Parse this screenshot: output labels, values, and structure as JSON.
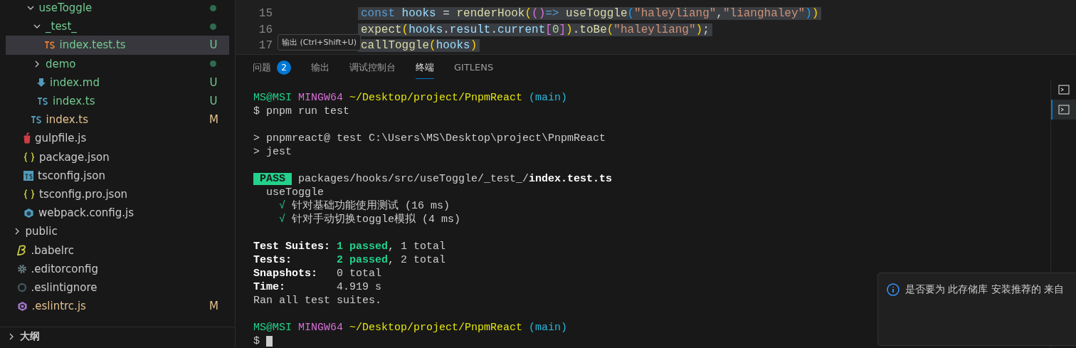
{
  "explorer": {
    "tree": [
      {
        "children": [
          {
            "children": [
              {
                "label": "useToggle",
                "kind": "folder",
                "expanded": true,
                "color": "#73c991",
                "selected": false,
                "dot": true,
                "children": [
                  {
                    "label": "_test_",
                    "kind": "folder",
                    "expanded": true,
                    "color": "#73c991",
                    "selected": false,
                    "dot": true,
                    "children": [
                      {
                        "label": "index.test.ts",
                        "kind": "ts-test",
                        "color": "#73c991",
                        "selected": true,
                        "badge": "U"
                      }
                    ]
                  },
                  {
                    "label": "demo",
                    "kind": "folder",
                    "expanded": false,
                    "color": "#73c991",
                    "selected": false,
                    "dot": true
                  },
                  {
                    "label": "index.md",
                    "kind": "md",
                    "color": "#73c991",
                    "selected": false,
                    "badge": "U"
                  },
                  {
                    "label": "index.ts",
                    "kind": "ts",
                    "color": "#73c991",
                    "selected": false,
                    "badge": "U"
                  }
                ]
              },
              {
                "label": "index.ts",
                "kind": "ts",
                "color": "#e2c08d",
                "selected": false,
                "badge": "M"
              }
            ]
          },
          {
            "label": "gulpfile.js",
            "kind": "gulp",
            "color": "#cccccc",
            "selected": false
          },
          {
            "label": "package.json",
            "kind": "json",
            "color": "#cccccc",
            "selected": false
          },
          {
            "label": "tsconfig.json",
            "kind": "tsconfig",
            "color": "#cccccc",
            "selected": false
          },
          {
            "label": "tsconfig.pro.json",
            "kind": "json",
            "color": "#cccccc",
            "selected": false
          },
          {
            "label": "webpack.config.js",
            "kind": "webpack",
            "color": "#cccccc",
            "selected": false
          }
        ]
      },
      {
        "label": "public",
        "kind": "folder",
        "expanded": false,
        "color": "#cccccc",
        "selected": false
      },
      {
        "label": ".babelrc",
        "kind": "babel",
        "color": "#cccccc",
        "selected": false
      },
      {
        "label": ".editorconfig",
        "kind": "gear",
        "color": "#cccccc",
        "selected": false
      },
      {
        "label": ".eslintignore",
        "kind": "ignore",
        "color": "#cccccc",
        "selected": false
      },
      {
        "label": ".eslintrc.js",
        "kind": "eslint",
        "color": "#e2c08d",
        "selected": false,
        "badge": "M"
      }
    ],
    "sections": [
      {
        "label": "大纲",
        "expanded": false
      }
    ]
  },
  "editor": {
    "lines": [
      {
        "number": "15",
        "tokens": [
          {
            "t": "const ",
            "kind": "keyword"
          },
          {
            "t": "hooks",
            "kind": "var"
          },
          {
            "t": " = ",
            "kind": "plain"
          },
          {
            "t": "renderHook",
            "kind": "func"
          },
          {
            "t": "(",
            "kind": "bracket1"
          },
          {
            "t": "()",
            "kind": "bracket2"
          },
          {
            "t": "=> ",
            "kind": "keyword"
          },
          {
            "t": "useToggle",
            "kind": "func"
          },
          {
            "t": "(",
            "kind": "bracket3"
          },
          {
            "t": "\"haleyliang\"",
            "kind": "string"
          },
          {
            "t": ",",
            "kind": "plain"
          },
          {
            "t": "\"lianghaley\"",
            "kind": "string"
          },
          {
            "t": ")",
            "kind": "bracket3"
          },
          {
            "t": ")",
            "kind": "bracket1"
          }
        ]
      },
      {
        "number": "16",
        "tokens": [
          {
            "t": "expect",
            "kind": "func"
          },
          {
            "t": "(",
            "kind": "bracket1"
          },
          {
            "t": "hooks",
            "kind": "var"
          },
          {
            "t": ".",
            "kind": "plain"
          },
          {
            "t": "result",
            "kind": "var"
          },
          {
            "t": ".",
            "kind": "plain"
          },
          {
            "t": "current",
            "kind": "var"
          },
          {
            "t": "[",
            "kind": "bracket2"
          },
          {
            "t": "0",
            "kind": "number"
          },
          {
            "t": "]",
            "kind": "bracket2"
          },
          {
            "t": ")",
            "kind": "bracket1"
          },
          {
            "t": ".",
            "kind": "plain"
          },
          {
            "t": "toBe",
            "kind": "func"
          },
          {
            "t": "(",
            "kind": "bracket1"
          },
          {
            "t": "\"haleyliang\"",
            "kind": "string"
          },
          {
            "t": ")",
            "kind": "bracket1"
          },
          {
            "t": ";",
            "kind": "plain"
          }
        ]
      },
      {
        "number": "17",
        "tokens": [
          {
            "t": "callToggle",
            "kind": "func"
          },
          {
            "t": "(",
            "kind": "bracket1"
          },
          {
            "t": "hooks",
            "kind": "var"
          },
          {
            "t": ")",
            "kind": "bracket1"
          }
        ]
      }
    ]
  },
  "panel": {
    "tooltip": "输出 (Ctrl+Shift+U)",
    "tabs": [
      {
        "label": "问题",
        "count": "2",
        "selected": false
      },
      {
        "label": "输出",
        "selected": false
      },
      {
        "label": "调试控制台",
        "selected": false
      },
      {
        "label": "终端",
        "selected": true
      },
      {
        "label": "GITLENS",
        "selected": false
      }
    ],
    "terminal": [
      {
        "kind": "text",
        "segments": [
          {
            "t": "MS@MSI ",
            "kind": "green"
          },
          {
            "t": "MINGW64 ",
            "kind": "magenta"
          },
          {
            "t": "~/Desktop/project/PnpmReact ",
            "kind": "yellow"
          },
          {
            "t": "(main)",
            "kind": "cyan"
          }
        ]
      },
      {
        "kind": "text",
        "segments": [
          {
            "t": "$ pnpm run test",
            "kind": "plain"
          }
        ]
      },
      {
        "kind": "blank"
      },
      {
        "kind": "text",
        "segments": [
          {
            "t": "> pnpmreact@ test C:\\Users\\MS\\Desktop\\project\\PnpmReact",
            "kind": "plain"
          }
        ]
      },
      {
        "kind": "text",
        "segments": [
          {
            "t": "> jest",
            "kind": "plain"
          }
        ]
      },
      {
        "kind": "blank"
      },
      {
        "kind": "text",
        "segments": [
          {
            "t": " PASS ",
            "kind": "pass"
          },
          {
            "t": " packages/hooks/src/useToggle/_test_/",
            "kind": "plain"
          },
          {
            "t": "index.test.ts",
            "kind": "bold"
          }
        ]
      },
      {
        "kind": "text",
        "segments": [
          {
            "t": "  useToggle",
            "kind": "plain"
          }
        ]
      },
      {
        "kind": "text",
        "segments": [
          {
            "t": "    √ ",
            "kind": "green"
          },
          {
            "t": "针对基础功能使用测试 (16 ms)",
            "kind": "plain"
          }
        ]
      },
      {
        "kind": "text",
        "segments": [
          {
            "t": "    √ ",
            "kind": "green"
          },
          {
            "t": "针对手动切换toggle模拟 (4 ms)",
            "kind": "plain"
          }
        ]
      },
      {
        "kind": "blank"
      },
      {
        "kind": "text",
        "segments": [
          {
            "t": "Test Suites: ",
            "kind": "bold"
          },
          {
            "t": "1 passed",
            "kind": "greenbold"
          },
          {
            "t": ", 1 total",
            "kind": "plain"
          }
        ]
      },
      {
        "kind": "text",
        "segments": [
          {
            "t": "Tests:       ",
            "kind": "bold"
          },
          {
            "t": "2 passed",
            "kind": "greenbold"
          },
          {
            "t": ", 2 total",
            "kind": "plain"
          }
        ]
      },
      {
        "kind": "text",
        "segments": [
          {
            "t": "Snapshots:   ",
            "kind": "bold"
          },
          {
            "t": "0 total",
            "kind": "plain"
          }
        ]
      },
      {
        "kind": "text",
        "segments": [
          {
            "t": "Time:        ",
            "kind": "bold"
          },
          {
            "t": "4.919 s",
            "kind": "plain"
          }
        ]
      },
      {
        "kind": "text",
        "segments": [
          {
            "t": "Ran all test suites.",
            "kind": "plain"
          }
        ]
      },
      {
        "kind": "blank"
      },
      {
        "kind": "text",
        "segments": [
          {
            "t": "MS@MSI ",
            "kind": "green"
          },
          {
            "t": "MINGW64 ",
            "kind": "magenta"
          },
          {
            "t": "~/Desktop/project/PnpmReact ",
            "kind": "yellow"
          },
          {
            "t": "(main)",
            "kind": "cyan"
          }
        ]
      },
      {
        "kind": "prompt",
        "segments": [
          {
            "t": "$",
            "kind": "plain"
          }
        ]
      }
    ],
    "terminal_list": [
      {
        "selected": false
      },
      {
        "selected": true
      }
    ]
  },
  "notification": {
    "message": "是否要为 此存储库 安装推荐的 来自"
  }
}
